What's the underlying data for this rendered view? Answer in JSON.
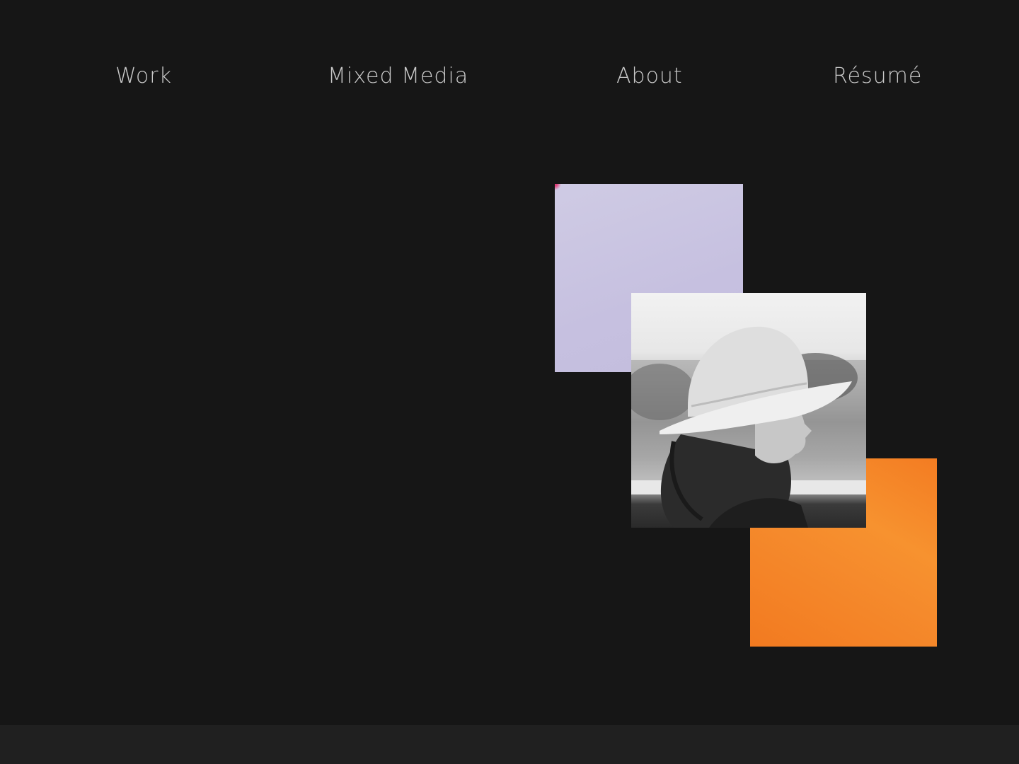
{
  "nav": {
    "items": [
      {
        "label": "Work"
      },
      {
        "label": "Mixed Media"
      },
      {
        "label": "About"
      },
      {
        "label": "Résumé"
      }
    ]
  },
  "collage": {
    "lilac_color": "#c6c0e0",
    "orange_color": "#f58a2c",
    "photo_subject": "portrait-photo"
  },
  "theme": {
    "background": "#161616",
    "nav_text_color": "#c9c9c9",
    "footer_color": "#202020"
  }
}
